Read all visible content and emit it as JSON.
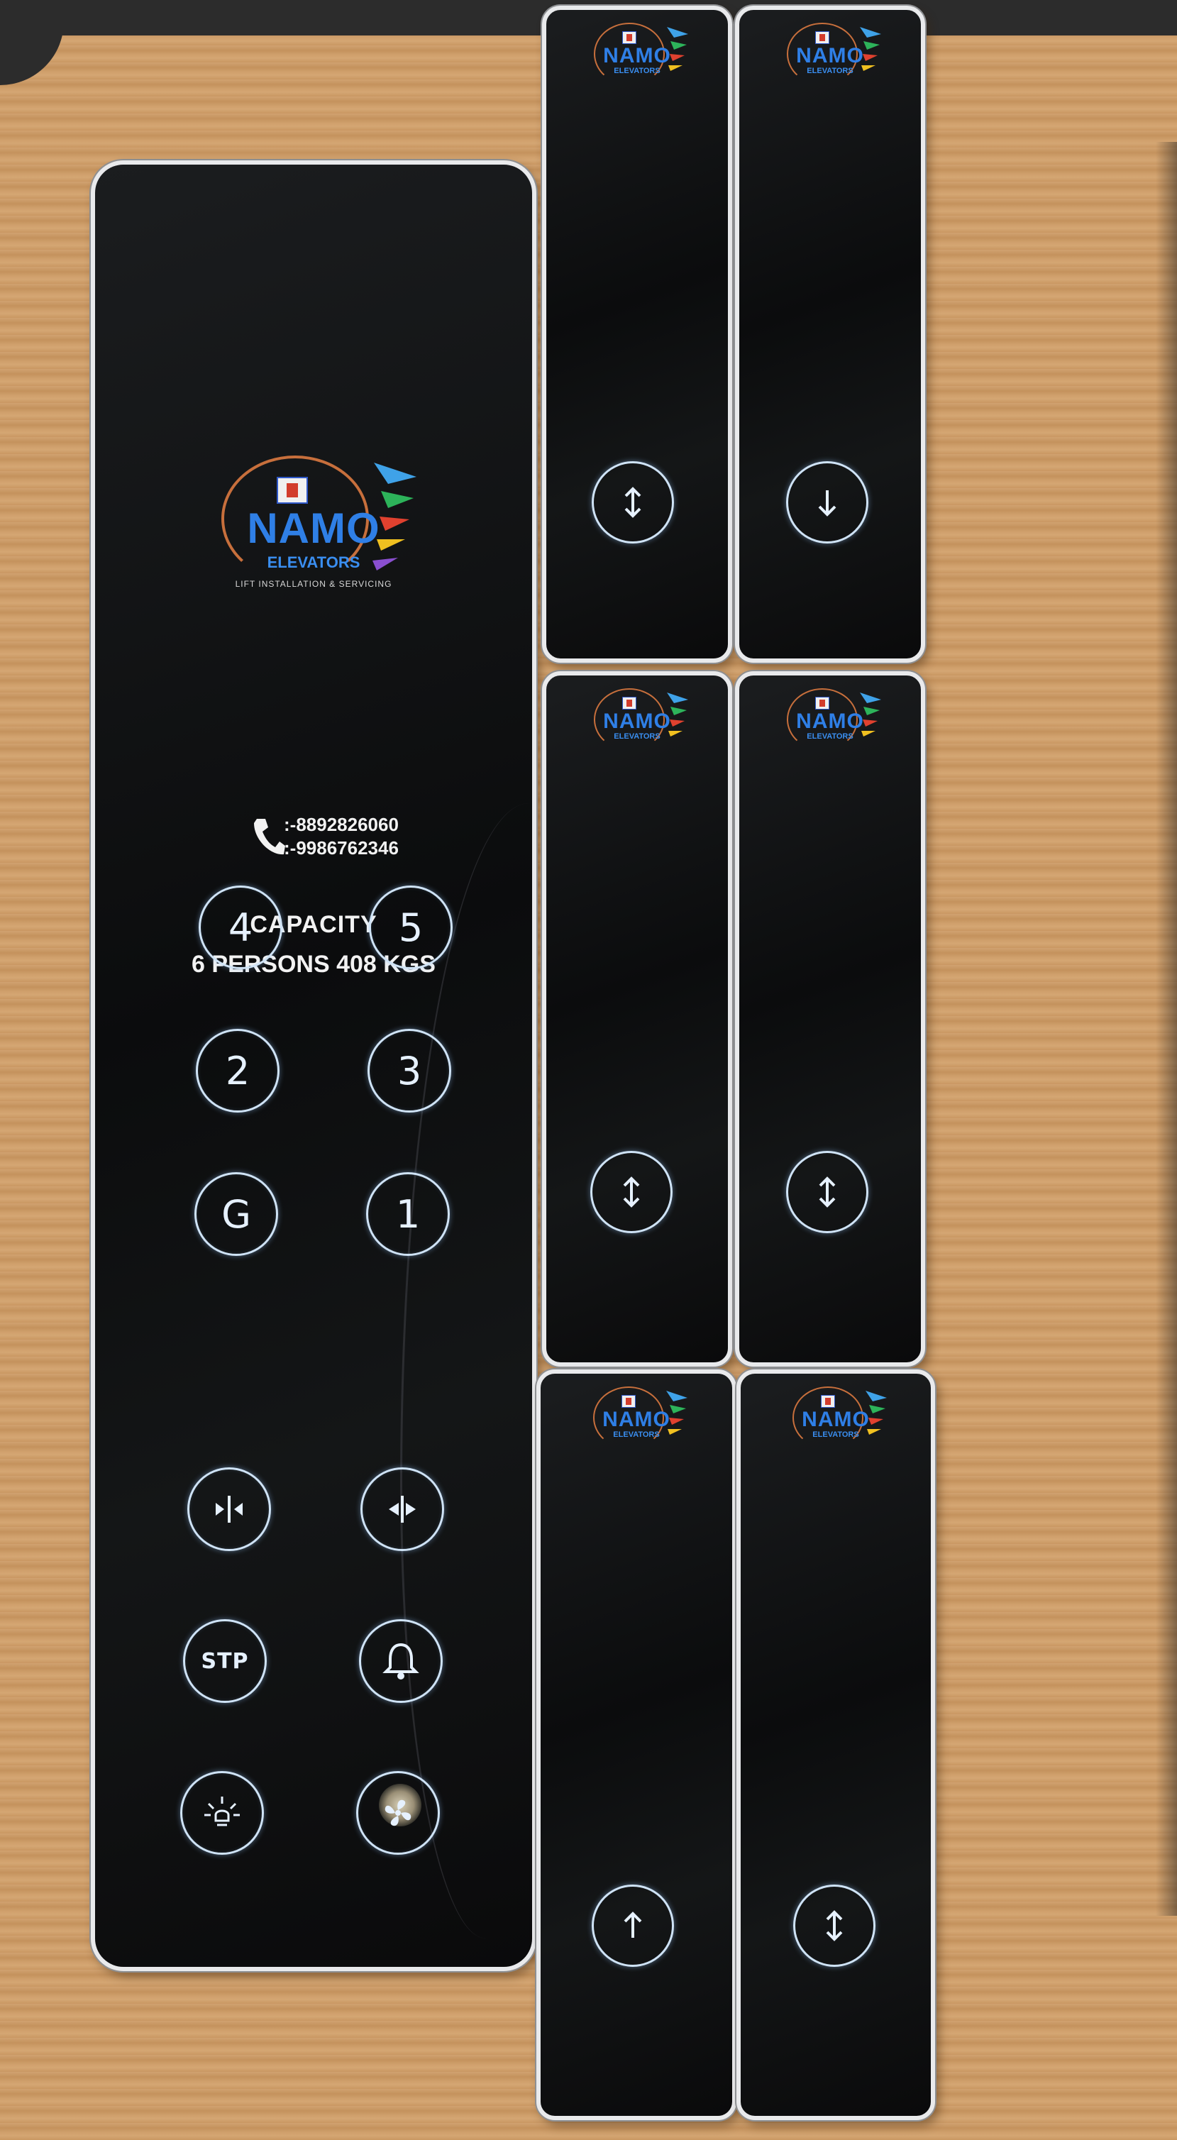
{
  "main_panel": {
    "logo": {
      "brand": "NAMO",
      "sub": "ELEVATORS",
      "tagline": "LIFT INSTALLATION & SERVICING"
    },
    "contact": {
      "phones": [
        ":-8892826060",
        ":-9986762346"
      ]
    },
    "capacity": {
      "title": "CAPACITY",
      "detail": "6 PERSONS 408 KGS"
    },
    "floor_buttons": [
      "4",
      "5",
      "2",
      "3",
      "G",
      "1"
    ],
    "control_buttons": {
      "stop_label": "STP"
    }
  },
  "hall_panels": [
    {
      "brand": "NAMO",
      "sub": "ELEVATORS",
      "direction": "up-down"
    },
    {
      "brand": "NAMO",
      "sub": "ELEVATORS",
      "direction": "down"
    },
    {
      "brand": "NAMO",
      "sub": "ELEVATORS",
      "direction": "up-down"
    },
    {
      "brand": "NAMO",
      "sub": "ELEVATORS",
      "direction": "up-down"
    },
    {
      "brand": "NAMO",
      "sub": "ELEVATORS",
      "direction": "up"
    },
    {
      "brand": "NAMO",
      "sub": "ELEVATORS",
      "direction": "up-down"
    }
  ],
  "colors": {
    "brand_blue": "#2f7fe6",
    "button_glow": "#cfe3f6",
    "panel_black": "#0b0c0d",
    "wood": "#cf9f6b"
  }
}
